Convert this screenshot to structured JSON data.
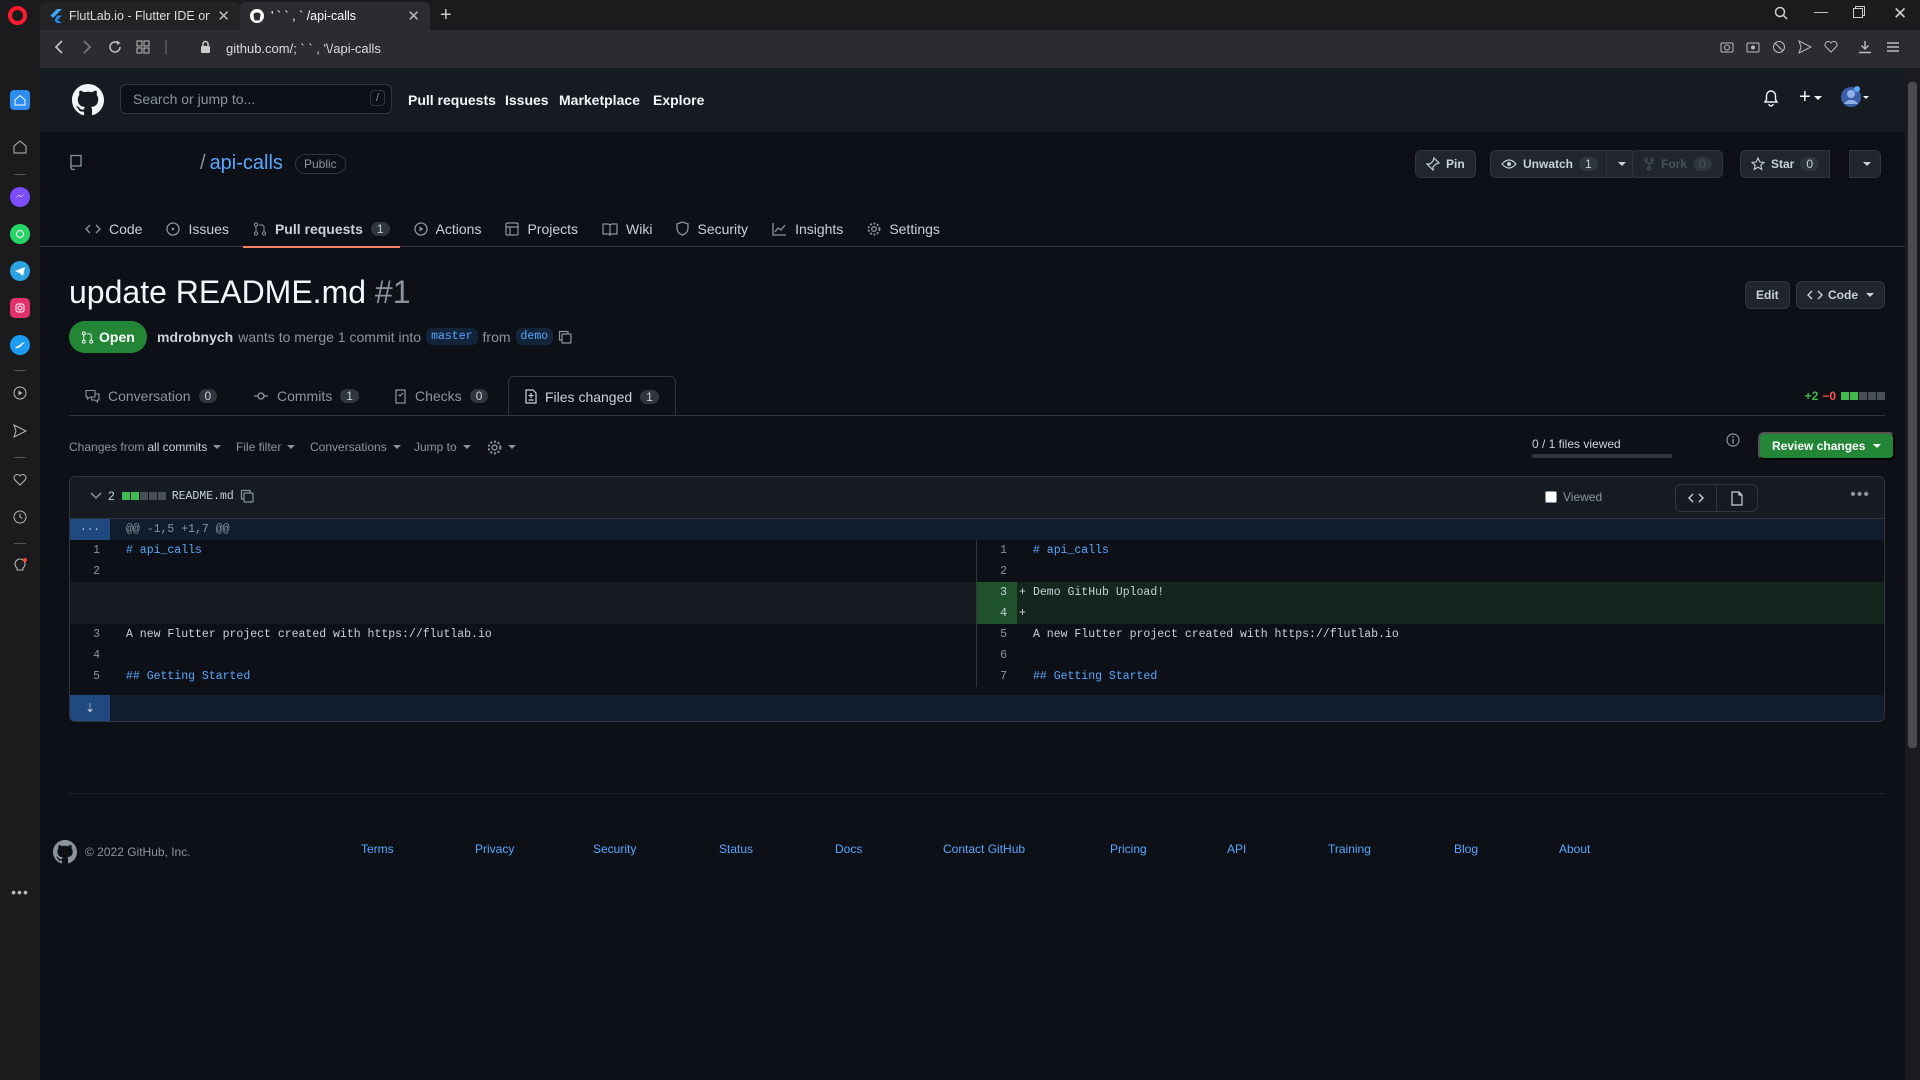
{
  "browser": {
    "tabs": [
      {
        "title": "FlutLab.io - Flutter IDE onli",
        "active": false
      },
      {
        "title": "' ` ` , ` /api-calls",
        "active": true
      }
    ],
    "url": "github.com/; ` ` ,  '\\/api-calls"
  },
  "github": {
    "search_placeholder": "Search or jump to...",
    "search_key": "/",
    "nav": [
      "Pull requests",
      "Issues",
      "Marketplace",
      "Explore"
    ]
  },
  "repo": {
    "name": "api-calls",
    "visibility": "Public",
    "pin_label": "Pin",
    "unwatch_label": "Unwatch",
    "unwatch_count": "1",
    "fork_label": "Fork",
    "fork_count": "0",
    "star_label": "Star",
    "star_count": "0",
    "tabs": [
      {
        "label": "Code",
        "icon": "code-icon"
      },
      {
        "label": "Issues",
        "icon": "issue-icon"
      },
      {
        "label": "Pull requests",
        "icon": "pull-request-icon",
        "count": "1",
        "selected": true
      },
      {
        "label": "Actions",
        "icon": "play-icon"
      },
      {
        "label": "Projects",
        "icon": "table-icon"
      },
      {
        "label": "Wiki",
        "icon": "book-icon"
      },
      {
        "label": "Security",
        "icon": "shield-icon"
      },
      {
        "label": "Insights",
        "icon": "graph-icon"
      },
      {
        "label": "Settings",
        "icon": "gear-icon"
      }
    ]
  },
  "pr": {
    "title": "update README.md",
    "number": "#1",
    "state": "Open",
    "author": "mdrobnych",
    "merge_text_1": "wants to merge 1 commit into",
    "base_branch": "master",
    "from_text": "from",
    "head_branch": "demo",
    "edit_label": "Edit",
    "code_label": "Code",
    "tabs": [
      {
        "label": "Conversation",
        "count": "0"
      },
      {
        "label": "Commits",
        "count": "1"
      },
      {
        "label": "Checks",
        "count": "0"
      },
      {
        "label": "Files changed",
        "count": "1",
        "selected": true
      }
    ],
    "additions": "+2",
    "deletions": "−0"
  },
  "toolbar": {
    "changes_from": "Changes from",
    "all_commits": "all commits",
    "file_filter": "File filter",
    "conversations": "Conversations",
    "jump_to": "Jump to",
    "files_viewed": "0 / 1 files viewed",
    "review_changes": "Review changes"
  },
  "diff": {
    "changes_count": "2",
    "file_name": "README.md",
    "viewed_label": "Viewed",
    "hunk_expander": "...",
    "hunk_header": "@@ -1,5 +1,7 @@",
    "rows": [
      {
        "left_num": "1",
        "left_code": "# api_calls",
        "right_num": "1",
        "right_code": "# api_calls",
        "type": "context",
        "header": true
      },
      {
        "left_num": "2",
        "left_code": "",
        "right_num": "2",
        "right_code": "",
        "type": "context"
      },
      {
        "left_num": "",
        "left_code": "",
        "right_num": "3",
        "right_code": "Demo GitHub Upload!",
        "type": "add"
      },
      {
        "left_num": "",
        "left_code": "",
        "right_num": "4",
        "right_code": "",
        "type": "add"
      },
      {
        "left_num": "3",
        "left_code": "A new Flutter project created with https://flutlab.io",
        "right_num": "5",
        "right_code": "A new Flutter project created with https://flutlab.io",
        "type": "context"
      },
      {
        "left_num": "4",
        "left_code": "",
        "right_num": "6",
        "right_code": "",
        "type": "context"
      },
      {
        "left_num": "5",
        "left_code": "## Getting Started",
        "right_num": "7",
        "right_code": "## Getting Started",
        "type": "context",
        "header": true
      }
    ]
  },
  "footer": {
    "copyright": "© 2022 GitHub, Inc.",
    "links": [
      "Terms",
      "Privacy",
      "Security",
      "Status",
      "Docs",
      "Contact GitHub",
      "Pricing",
      "API",
      "Training",
      "Blog",
      "About"
    ]
  },
  "colors": {
    "accent": "#58a6ff",
    "open_green": "#238636",
    "tab_underline": "#f78166",
    "background": "#0d1117"
  }
}
